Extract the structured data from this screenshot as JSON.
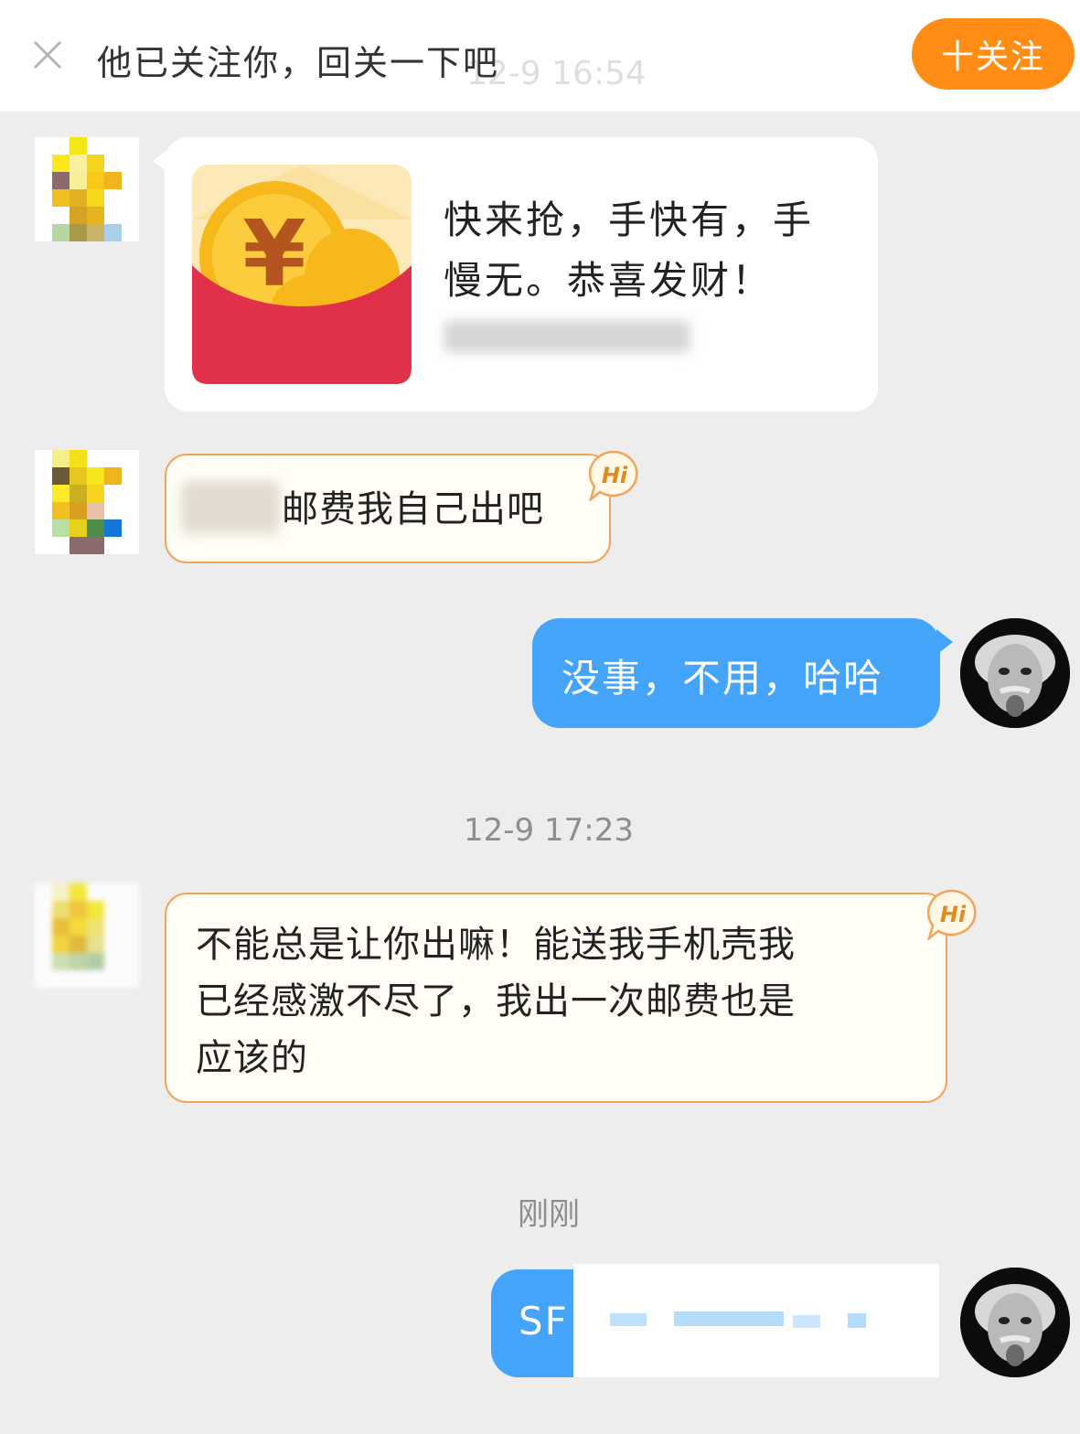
{
  "follow_bar": {
    "prompt_text": "他已关注你，回关一下吧",
    "follow_button_label": "十关注",
    "background_timestamp": "12-9 16:54"
  },
  "messages": {
    "red_packet": {
      "text_line1": "快来抢，手快有，手",
      "text_line2": "慢无。恭喜发财！"
    },
    "incoming_1": {
      "visible_text": "邮费我自己出吧"
    },
    "outgoing_1": {
      "text": "没事，不用，哈哈"
    },
    "timestamp_1": "12-9 17:23",
    "incoming_2": {
      "line1": "不能总是让你出嘛！能送我手机壳我",
      "line2": "已经感激不尽了，我出一次邮费也是",
      "line3": "应该的"
    },
    "timestamp_2": "刚刚",
    "outgoing_2": {
      "visible_prefix": "SF"
    }
  },
  "badges": {
    "hi_label": "Hi"
  },
  "colors": {
    "follow_button": "#ff8c14",
    "outgoing_bubble": "#44a4f9",
    "incoming_cream_border": "#f2a45a",
    "red_packet": "#e0304a",
    "coin": "#f7b81c"
  },
  "icons": {
    "close": "close-icon",
    "red_packet": "red-packet-icon",
    "hi": "hi-badge-icon"
  }
}
